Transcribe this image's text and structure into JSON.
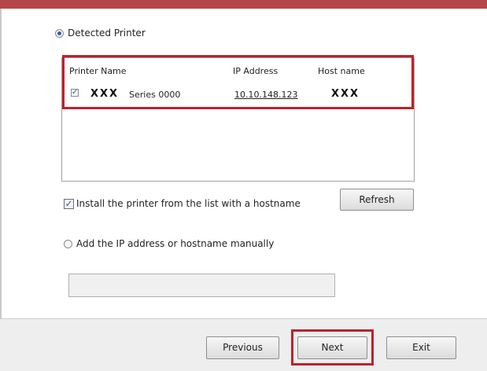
{
  "detected_printer": {
    "label": "Detected Printer",
    "selected": true
  },
  "printer_list": {
    "columns": [
      "Printer Name",
      "IP Address",
      "Host name"
    ],
    "rows": [
      {
        "checked": true,
        "name_bold": "XXX",
        "name_rest": "Series 0000",
        "ip": "10.10.148.123",
        "host": "XXX"
      }
    ]
  },
  "install_hostname": {
    "label": "Install the printer from the list with a hostname",
    "checked": true
  },
  "refresh_label": "Refresh",
  "manual_option": {
    "label": "Add the IP address or hostname manually",
    "selected": false
  },
  "manual_input": {
    "value": "",
    "enabled": false
  },
  "footer": {
    "previous_label": "Previous",
    "next_label": "Next",
    "exit_label": "Exit"
  },
  "colors": {
    "highlight": "#c0202a",
    "top_bar": "#b5474a"
  }
}
